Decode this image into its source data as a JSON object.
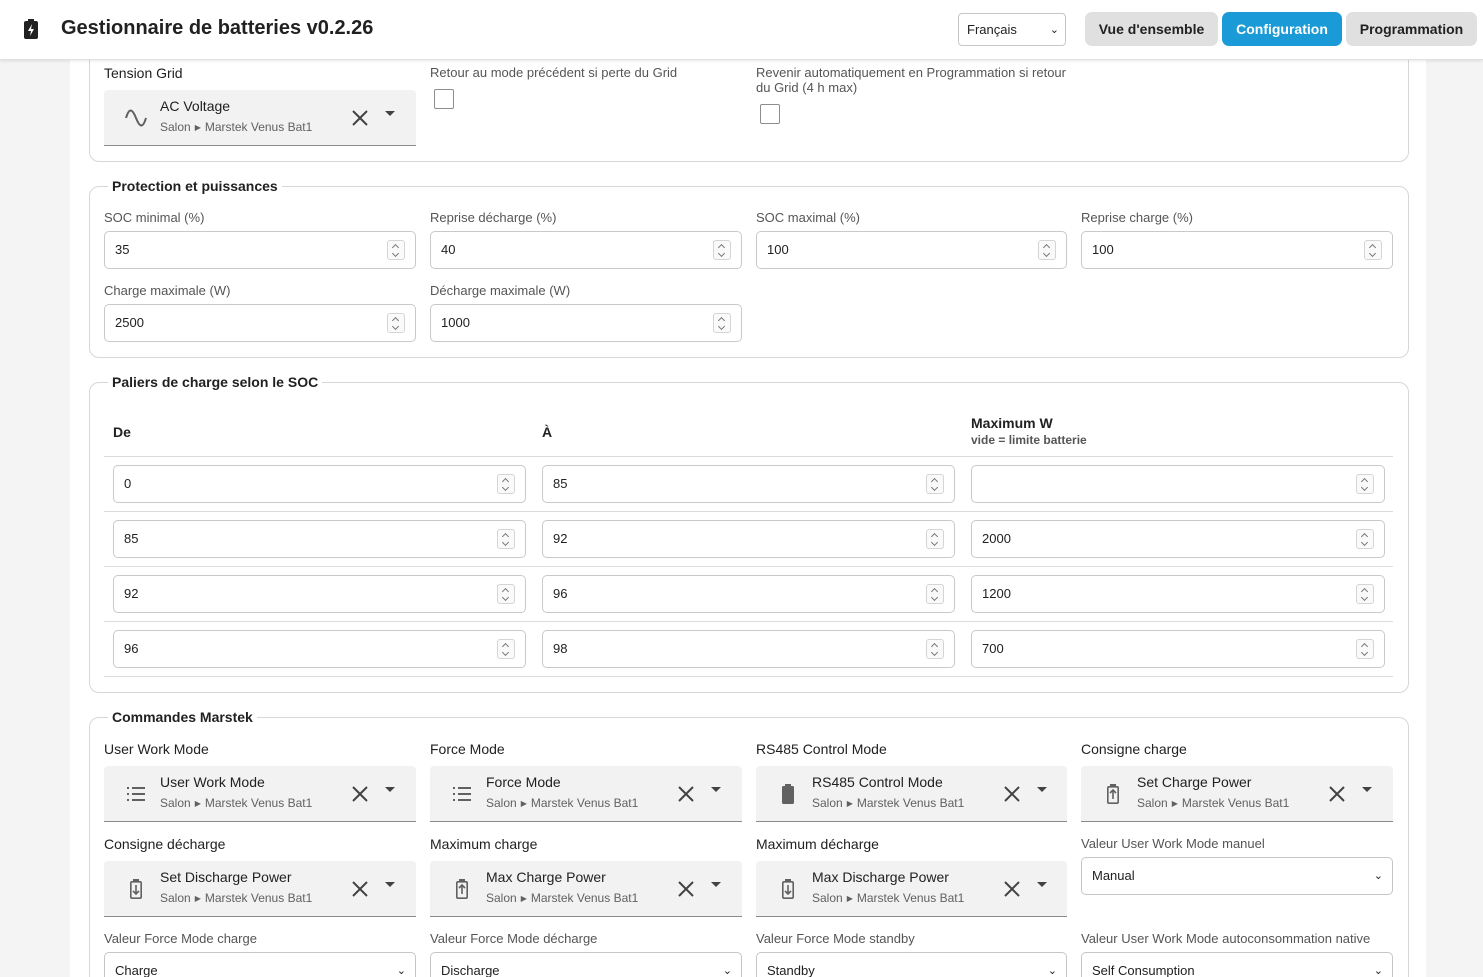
{
  "header": {
    "title": "Gestionnaire de batteries v0.2.26",
    "language": "Français",
    "nav": [
      "Vue d'ensemble",
      "Configuration",
      "Programmation"
    ],
    "active_nav": "Configuration",
    "accent_color": "#1a9ad6"
  },
  "grid": {
    "tension_label": "Tension Grid",
    "tension_entity": {
      "title": "AC Voltage",
      "area": "Salon",
      "device": "Marstek Venus Bat1",
      "icon": "sine-wave-icon"
    },
    "return_previous_label": "Retour au mode précédent si perte du Grid",
    "return_previous_checked": false,
    "auto_schedule_label": "Revenir automatiquement en Programmation si retour du Grid (4 h max)",
    "auto_schedule_checked": false
  },
  "protection": {
    "legend": "Protection et puissances",
    "soc_min_label": "SOC minimal (%)",
    "soc_min": "35",
    "reprise_decharge_label": "Reprise décharge (%)",
    "reprise_decharge": "40",
    "soc_max_label": "SOC maximal (%)",
    "soc_max": "100",
    "reprise_charge_label": "Reprise charge (%)",
    "reprise_charge": "100",
    "charge_max_label": "Charge maximale (W)",
    "charge_max": "2500",
    "decharge_max_label": "Décharge maximale (W)",
    "decharge_max": "1000"
  },
  "paliers": {
    "legend": "Paliers de charge selon le SOC",
    "col_de": "De",
    "col_a": "À",
    "col_max": "Maximum W",
    "col_max_sub": "vide = limite batterie",
    "rows": [
      {
        "de": "0",
        "a": "85",
        "max": ""
      },
      {
        "de": "85",
        "a": "92",
        "max": "2000"
      },
      {
        "de": "92",
        "a": "96",
        "max": "1200"
      },
      {
        "de": "96",
        "a": "98",
        "max": "700"
      }
    ]
  },
  "commandes": {
    "legend": "Commandes Marstek",
    "user_work_mode": {
      "label": "User Work Mode",
      "title": "User Work Mode",
      "area": "Salon",
      "device": "Marstek Venus Bat1",
      "icon": "list-icon"
    },
    "force_mode": {
      "label": "Force Mode",
      "title": "Force Mode",
      "area": "Salon",
      "device": "Marstek Venus Bat1",
      "icon": "list-icon"
    },
    "rs485": {
      "label": "RS485 Control Mode",
      "title": "RS485 Control Mode",
      "area": "Salon",
      "device": "Marstek Venus Bat1",
      "icon": "battery-icon"
    },
    "consigne_charge": {
      "label": "Consigne charge",
      "title": "Set Charge Power",
      "area": "Salon",
      "device": "Marstek Venus Bat1",
      "icon": "battery-charging-icon"
    },
    "consigne_decharge": {
      "label": "Consigne décharge",
      "title": "Set Discharge Power",
      "area": "Salon",
      "device": "Marstek Venus Bat1",
      "icon": "battery-discharging-icon"
    },
    "maximum_charge": {
      "label": "Maximum charge",
      "title": "Max Charge Power",
      "area": "Salon",
      "device": "Marstek Venus Bat1",
      "icon": "battery-charging-icon"
    },
    "maximum_decharge": {
      "label": "Maximum décharge",
      "title": "Max Discharge Power",
      "area": "Salon",
      "device": "Marstek Venus Bat1",
      "icon": "battery-discharging-icon"
    },
    "uwm_manuel": {
      "label": "Valeur User Work Mode manuel",
      "value": "Manual"
    },
    "fm_charge": {
      "label": "Valeur Force Mode charge",
      "value": "Charge"
    },
    "fm_decharge": {
      "label": "Valeur Force Mode décharge",
      "value": "Discharge"
    },
    "fm_standby": {
      "label": "Valeur Force Mode standby",
      "value": "Standby"
    },
    "uwm_auto": {
      "label": "Valeur User Work Mode autoconsommation native",
      "value": "Self Consumption"
    }
  }
}
